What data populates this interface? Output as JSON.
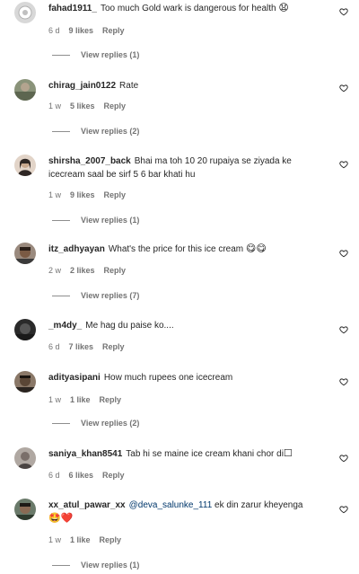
{
  "comments": [
    {
      "user": "fahad1911_",
      "text": "Too much Gold wark is dangerous for health",
      "emoji": "😧",
      "time": "6 d",
      "likes": "9 likes",
      "reply": "Reply",
      "view_replies": "View replies (1)",
      "avatar_color": "#d8d8d8"
    },
    {
      "user": "chirag_jain0122",
      "text": "Rate",
      "emoji": "",
      "time": "1 w",
      "likes": "5 likes",
      "reply": "Reply",
      "view_replies": "View replies (2)",
      "avatar_color": "#6f7a5e"
    },
    {
      "user": "shirsha_2007_back",
      "text": "Bhai ma toh 10 20 rupaiya se ziyada ke icecream saal be sirf 5 6 bar khati hu",
      "emoji": "",
      "time": "1 w",
      "likes": "9 likes",
      "reply": "Reply",
      "view_replies": "View replies (1)",
      "avatar_color": "#c9a98e"
    },
    {
      "user": "itz_adhyayan",
      "text": "What's the price for this ice cream",
      "emoji": "😋😋",
      "time": "2 w",
      "likes": "2 likes",
      "reply": "Reply",
      "view_replies": "View replies (7)",
      "avatar_color": "#6e4e3c"
    },
    {
      "user": "_m4dy_",
      "text": "Me hag du paise ko....",
      "emoji": "",
      "time": "6 d",
      "likes": "7 likes",
      "reply": "Reply",
      "view_replies": "",
      "avatar_color": "#3b3b3b"
    },
    {
      "user": "adityasipani",
      "text": "How much rupees one icecream",
      "emoji": "",
      "time": "1 w",
      "likes": "1 like",
      "reply": "Reply",
      "view_replies": "View replies (2)",
      "avatar_color": "#5a4636"
    },
    {
      "user": "saniya_khan8541",
      "text": "Tab hi se maine ice cream khani chor di",
      "emoji": "☐",
      "time": "6 d",
      "likes": "6 likes",
      "reply": "Reply",
      "view_replies": "",
      "avatar_color": "#7a6f6a"
    },
    {
      "user": "xx_atul_pawar_xx",
      "mention": "@deva_salunke_111",
      "text": "ek din zarur kheyenga",
      "emoji": "🤩❤️",
      "time": "1 w",
      "likes": "1 like",
      "reply": "Reply",
      "view_replies": "View replies (1)",
      "avatar_color": "#4a5a4a"
    }
  ],
  "icons": {
    "avatar": "profile-avatar",
    "heart": "heart-outline-icon"
  }
}
